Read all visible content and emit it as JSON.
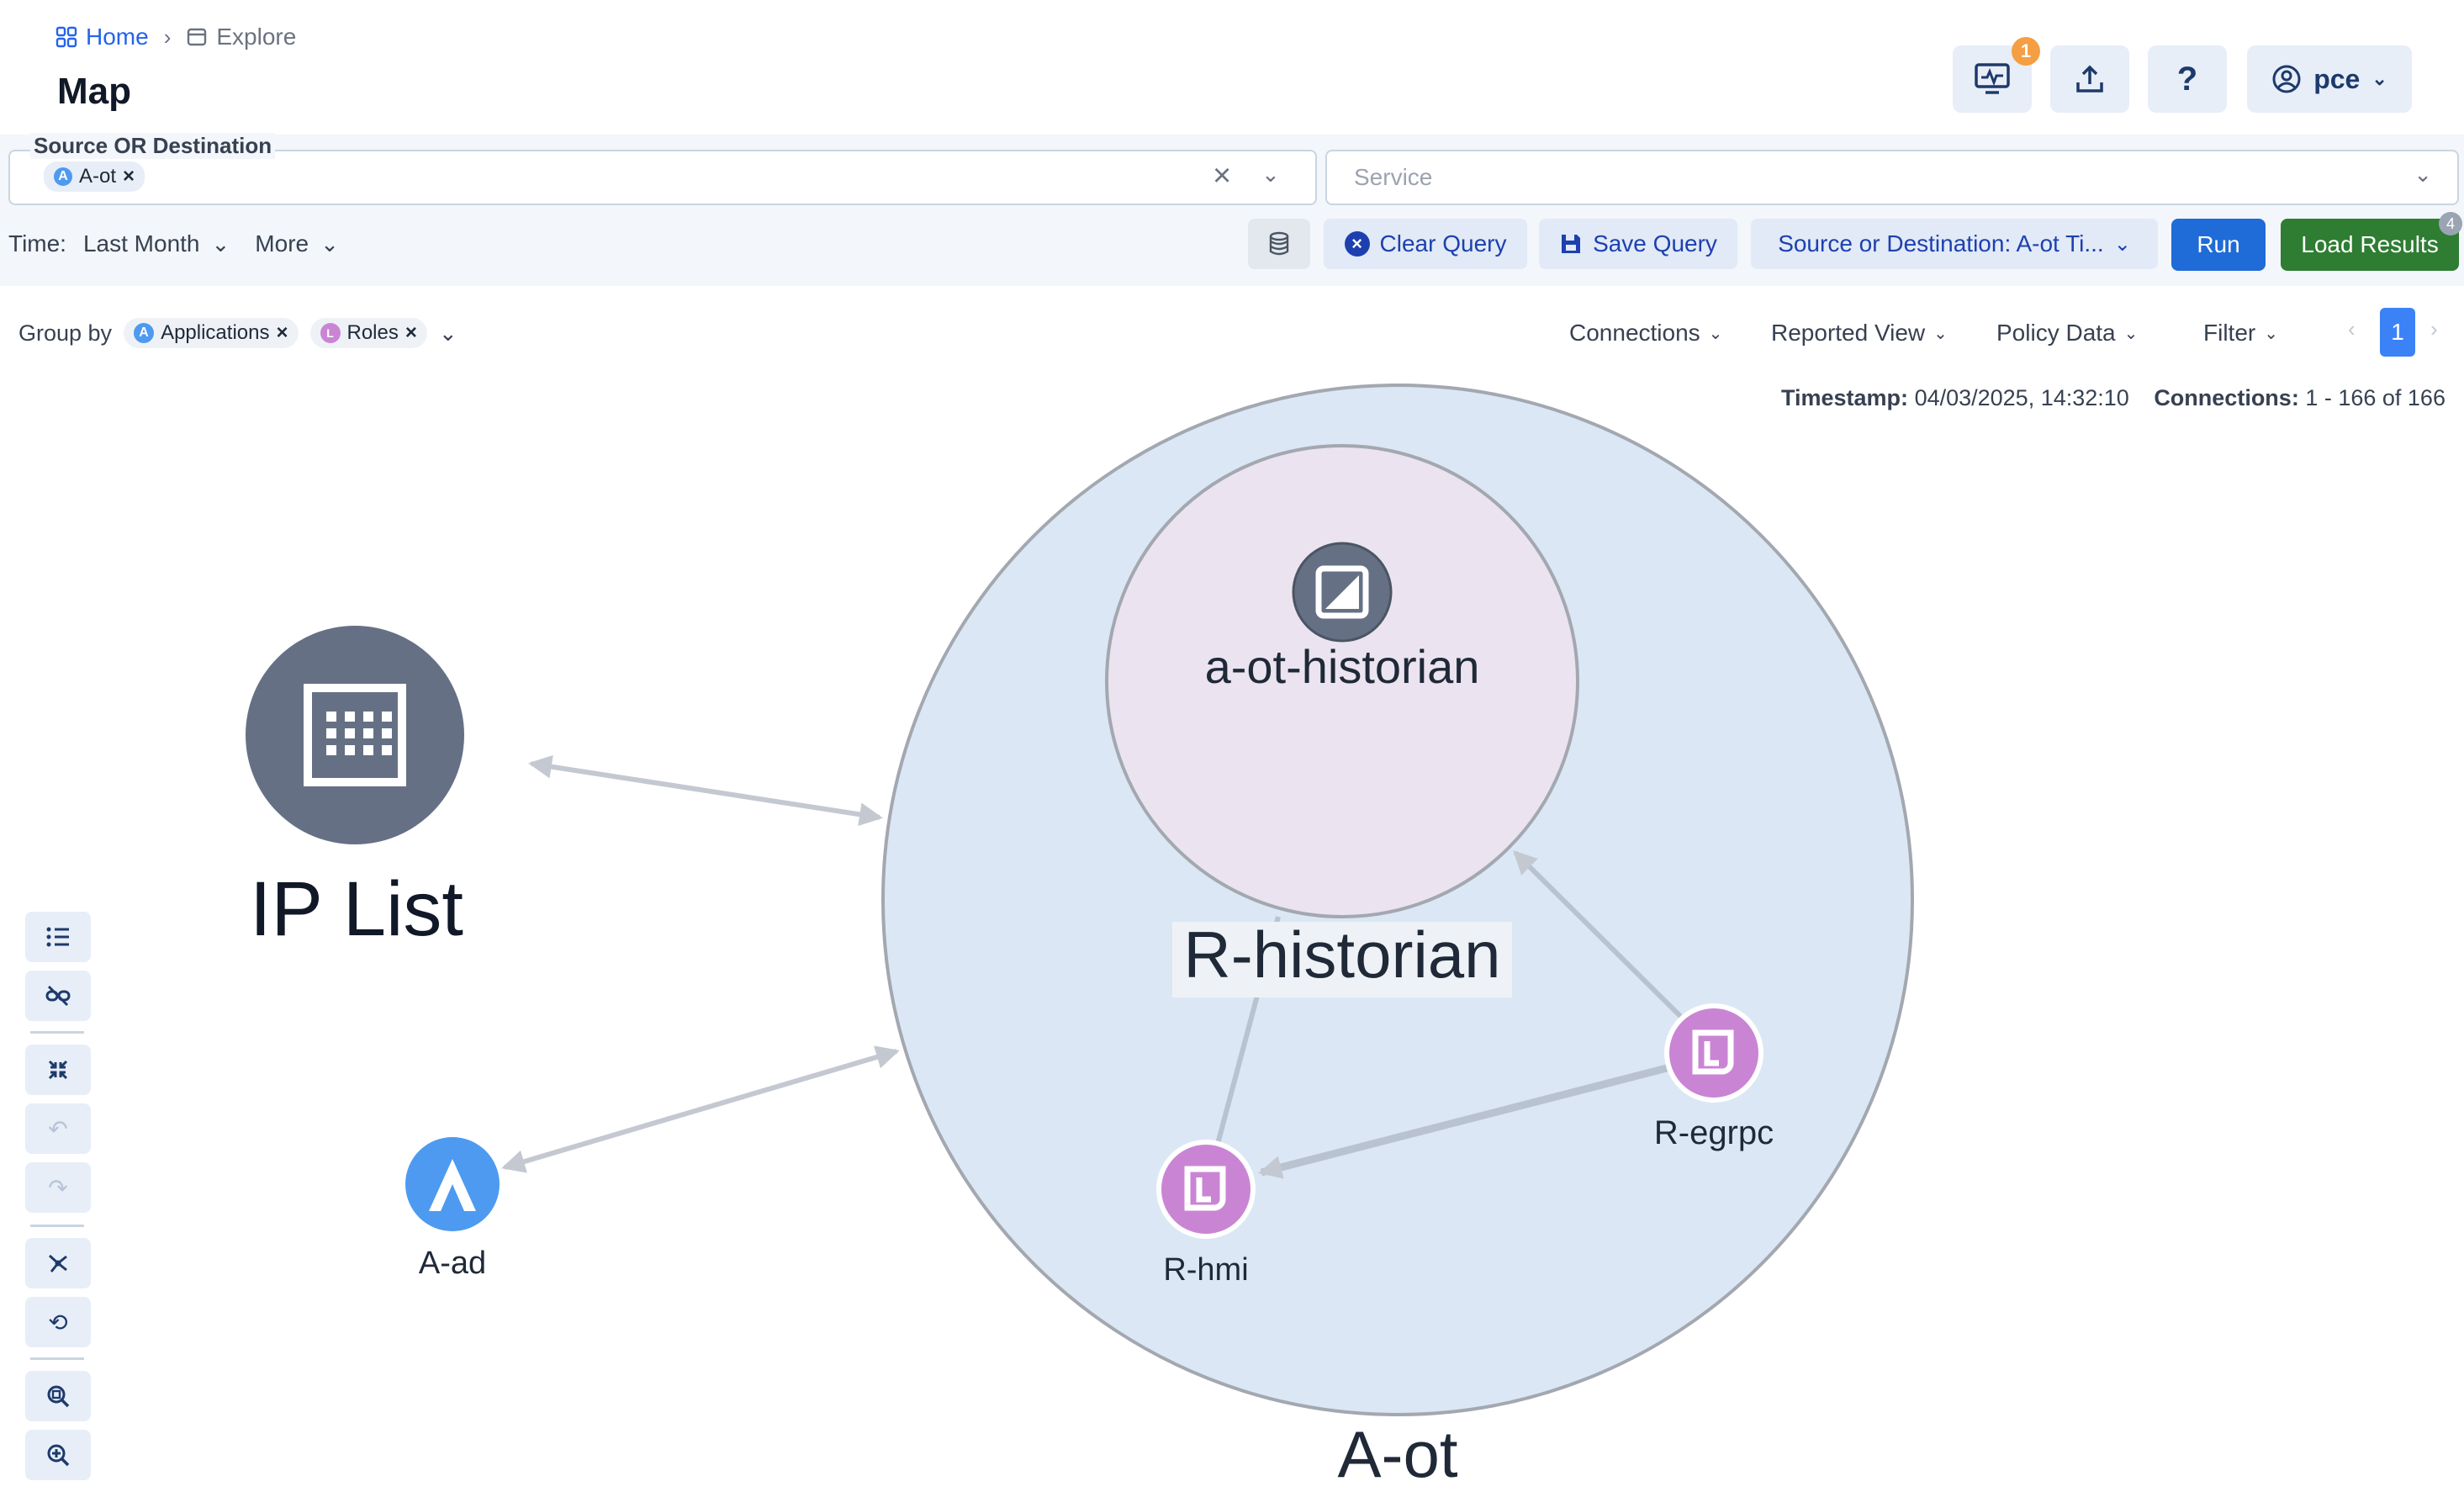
{
  "breadcrumb": {
    "home": "Home",
    "current": "Explore"
  },
  "page": {
    "title": "Map"
  },
  "header": {
    "notification_count": "1",
    "user": "pce"
  },
  "query": {
    "source_label": "Source OR Destination",
    "source_chip": "A-ot",
    "service_placeholder": "Service",
    "time_label": "Time:",
    "time_value": "Last Month",
    "more_label": "More",
    "clear_label": "Clear Query",
    "save_label": "Save Query",
    "saved_query": "Source or Destination: A-ot Ti...",
    "run_label": "Run",
    "load_label": "Load Results",
    "load_badge": "4"
  },
  "toolbar": {
    "group_by_label": "Group by",
    "group_chips": [
      "Applications",
      "Roles"
    ],
    "menus": [
      "Connections",
      "Reported View",
      "Policy Data",
      "Filter"
    ],
    "page": "1",
    "timestamp_label": "Timestamp:",
    "timestamp_value": "04/03/2025, 14:32:10",
    "connections_label": "Connections:",
    "connections_value": "1 - 166 of 166"
  },
  "map": {
    "nodes": {
      "ip_list": "IP List",
      "a_ad": "A-ad",
      "a_ot": "A-ot",
      "r_historian": "R-historian",
      "a_ot_historian": "a-ot-historian",
      "r_hmi": "R-hmi",
      "r_egrpc": "R-egrpc"
    }
  },
  "colors": {
    "accent": "#1f6bd8",
    "success": "#2e7d32",
    "app_circle": "#dbe7f4",
    "role_circle": "#ebe3f0",
    "role_node": "#c985d4",
    "app_node": "#4d9af0",
    "iplist_node": "#667085"
  }
}
